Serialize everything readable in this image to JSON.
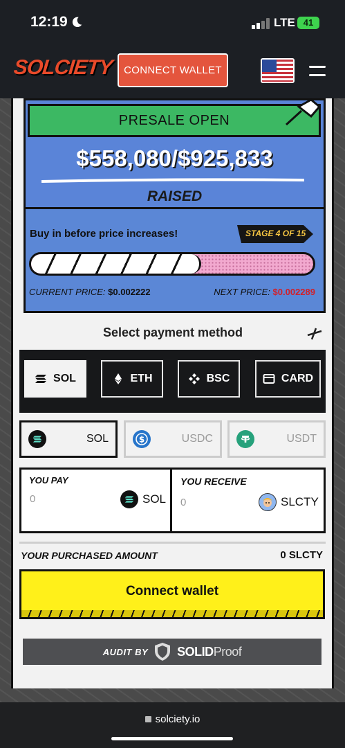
{
  "status_bar": {
    "time": "12:19",
    "network": "LTE",
    "battery": "41"
  },
  "header": {
    "logo": "SOLCIETY",
    "connect_label": "CONNECT WALLET",
    "language_flag": "us-flag-icon",
    "menu_icon": "menu-icon"
  },
  "presale": {
    "banner": "PRESALE OPEN",
    "amount": "$558,080/$925,833",
    "raised_label": "RAISED",
    "buy_in": "Buy in before price increases!",
    "stage": "STAGE 4 OF 15",
    "progress_fraction": 0.6028,
    "current_price_label": "CURRENT PRICE:",
    "current_price": "$0.002222",
    "next_price_label": "NEXT PRICE:",
    "next_price": "$0.002289"
  },
  "payment": {
    "title": "Select payment method",
    "methods": [
      {
        "label": "SOL",
        "icon": "solana-icon",
        "active": true
      },
      {
        "label": "ETH",
        "icon": "ethereum-icon",
        "active": false
      },
      {
        "label": "BSC",
        "icon": "bnb-icon",
        "active": false
      },
      {
        "label": "CARD",
        "icon": "card-icon",
        "active": false
      }
    ],
    "tokens": [
      {
        "label": "SOL",
        "icon": "solana-icon",
        "active": true
      },
      {
        "label": "USDC",
        "icon": "usdc-icon",
        "active": false
      },
      {
        "label": "USDT",
        "icon": "tether-icon",
        "active": false
      }
    ]
  },
  "exchange": {
    "pay_label": "YOU PAY",
    "pay_value": "0",
    "pay_token": "SOL",
    "receive_label": "YOU RECEIVE",
    "receive_value": "0",
    "receive_token": "SLCTY"
  },
  "purchased": {
    "label": "YOUR PURCHASED AMOUNT",
    "value": "0 SLCTY"
  },
  "wallet_button": "Connect wallet",
  "audit": {
    "label": "AUDIT BY",
    "brand_bold": "SOLID",
    "brand_light": "Proof"
  },
  "browser": {
    "url": "solciety.io"
  },
  "colors": {
    "accent": "#e4553d",
    "presale_green": "#3cb863",
    "panel_blue": "#5a84d8",
    "button_yellow": "#fff01a",
    "next_price_red": "#d0202a"
  }
}
